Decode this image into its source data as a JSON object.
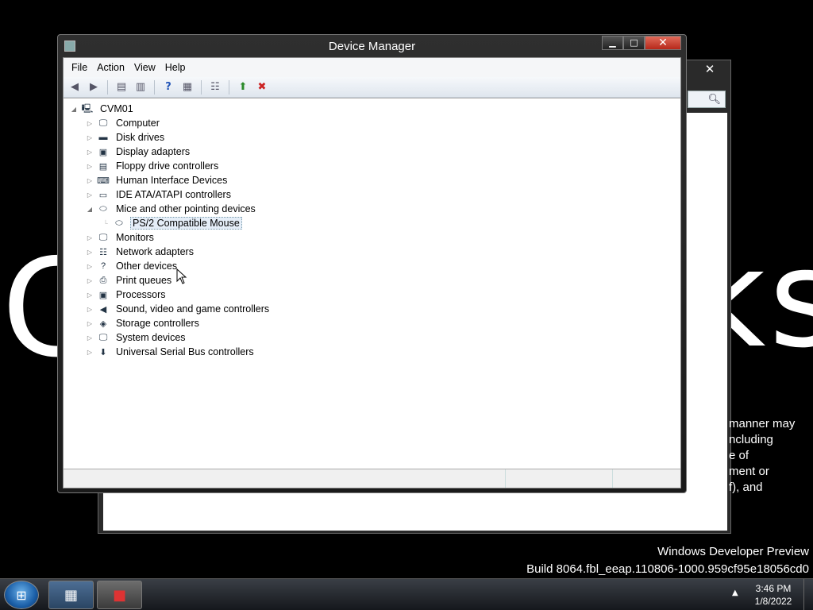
{
  "desktop": {
    "bg_text_left": "C",
    "bg_text_right": "ks",
    "watermark_line1": "Windows Developer Preview",
    "watermark_line2": "Build 8064.fbl_eeap.110806-1000.959cf95e18056cd0"
  },
  "background_window": {
    "close_label": "✕",
    "text_lines": [
      "manner may",
      "ncluding",
      "e of",
      "ment or",
      "f), and"
    ]
  },
  "window": {
    "title": "Device Manager",
    "minimize_label": "▁",
    "maximize_label": "□",
    "close_label": "✕"
  },
  "menu": {
    "items": [
      "File",
      "Action",
      "View",
      "Help"
    ]
  },
  "toolbar": {
    "icons": [
      "back-arrow-icon",
      "forward-arrow-icon",
      "show-hide-console-tree-icon",
      "properties-icon",
      "help-icon",
      "view-icon",
      "scan-hardware-icon",
      "update-driver-icon",
      "uninstall-icon"
    ]
  },
  "tree": {
    "root": "CVM01",
    "categories": [
      "Computer",
      "Disk drives",
      "Display adapters",
      "Floppy drive controllers",
      "Human Interface Devices",
      "IDE ATA/ATAPI controllers",
      "Mice and other pointing devices",
      "PS/2 Compatible Mouse",
      "Monitors",
      "Network adapters",
      "Other devices",
      "Print queues",
      "Processors",
      "Sound, video and game controllers",
      "Storage controllers",
      "System devices",
      "Universal Serial Bus controllers"
    ],
    "expanded": "Mice and other pointing devices",
    "selected": "PS/2 Compatible Mouse"
  },
  "taskbar": {
    "time": "3:46 PM",
    "date": "1/8/2022"
  }
}
